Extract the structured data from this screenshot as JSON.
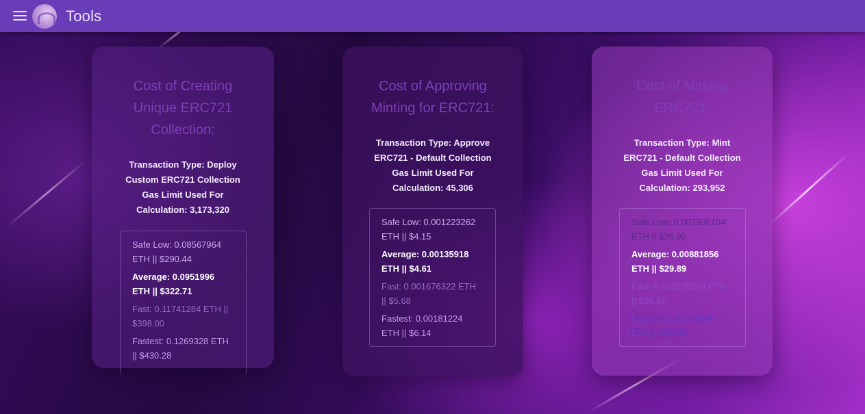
{
  "app": {
    "title": "Tools"
  },
  "cards": [
    {
      "title_lines": [
        "Cost of Creating",
        "Unique ERC721",
        "Collection:"
      ],
      "info_lines": [
        "Transaction Type: Deploy",
        "Custom ERC721 Collection",
        "Gas Limit Used For",
        "Calculation: 3,173,320"
      ],
      "prices": {
        "safe_low": [
          "Safe Low: 0.08567964",
          "ETH || $290.44"
        ],
        "average": [
          "Average: 0.0951996",
          "ETH || $322.71"
        ],
        "fast": [
          "Fast: 0.11741284 ETH ||",
          "$398.00"
        ],
        "fastest": [
          "Fastest: 0.1269328 ETH",
          "|| $430.28"
        ]
      }
    },
    {
      "title_lines": [
        "Cost of Approving",
        "Minting for ERC721:"
      ],
      "info_lines": [
        "Transaction Type: Approve",
        "ERC721 - Default Collection",
        "Gas Limit Used For",
        "Calculation: 45,306"
      ],
      "prices": {
        "safe_low": [
          "Safe Low: 0.001223262",
          "ETH || $4.15"
        ],
        "average": [
          "Average: 0.00135918",
          "ETH || $4.61"
        ],
        "fast": [
          "Fast: 0.001676322 ETH",
          "|| $5.68"
        ],
        "fastest": [
          "Fastest: 0.00181224",
          "ETH || $6.14"
        ]
      }
    },
    {
      "title_lines": [
        "Cost of Minting",
        "ERC721:"
      ],
      "info_lines": [
        "Transaction Type: Mint",
        "ERC721 - Default Collection",
        "Gas Limit Used For",
        "Calculation: 293,952"
      ],
      "prices": {
        "safe_low": [
          "Safe Low: 0.007936704",
          "ETH || $26.90"
        ],
        "average": [
          "Average: 0.00881856",
          "ETH || $29.89"
        ],
        "fast": [
          "Fast: 0.010876224 ETH",
          "|| $36.87"
        ],
        "fastest": [
          "Fastest: 0.01175808",
          "ETH || $39.86"
        ]
      }
    }
  ],
  "colors": {
    "topbar": "#6a3db8",
    "card_title": "#7e3fb8",
    "accent": "#a22fc8"
  },
  "icons": {
    "menu": "hamburger-menu-icon",
    "logo": "app-logo"
  }
}
